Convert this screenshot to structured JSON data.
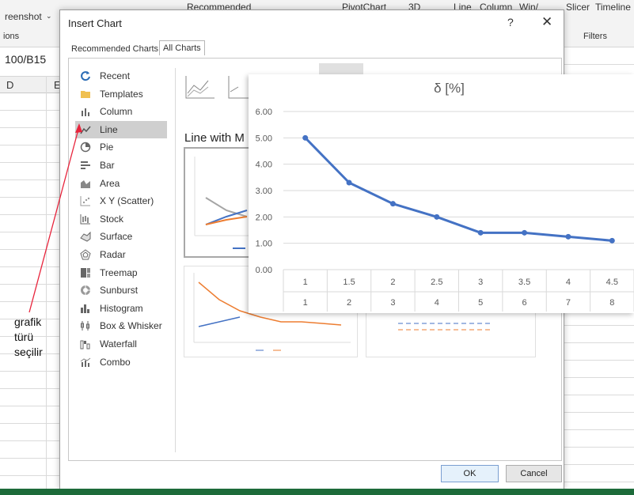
{
  "excel": {
    "ribbon": {
      "screenshot_label": "reenshot",
      "options_label": "ions",
      "recommended_label": "Recommended",
      "pivotchart_label": "PivotChart",
      "map3d_label": "3D",
      "line_label": "Line",
      "column_label": "Column",
      "winloss_label": "Win/",
      "slicer_label": "Slicer",
      "timeline_label": "Timeline",
      "filters_label": "Filters"
    },
    "name_box": "100/B15",
    "col_headers": [
      "D",
      "E"
    ]
  },
  "annotation": {
    "lines": [
      "grafik",
      "türü",
      "seçilir"
    ],
    "color": "#e8243c"
  },
  "dialog": {
    "title": "Insert Chart",
    "help_icon": "?",
    "close_icon": "✕",
    "tabs": [
      "Recommended Charts",
      "All Charts"
    ],
    "active_tab": "All Charts",
    "chart_types": [
      {
        "label": "Recent",
        "icon": "recent-icon"
      },
      {
        "label": "Templates",
        "icon": "templates-icon"
      },
      {
        "label": "Column",
        "icon": "column-chart-icon"
      },
      {
        "label": "Line",
        "icon": "line-chart-icon"
      },
      {
        "label": "Pie",
        "icon": "pie-chart-icon"
      },
      {
        "label": "Bar",
        "icon": "bar-chart-icon"
      },
      {
        "label": "Area",
        "icon": "area-chart-icon"
      },
      {
        "label": "X Y (Scatter)",
        "icon": "scatter-chart-icon"
      },
      {
        "label": "Stock",
        "icon": "stock-chart-icon"
      },
      {
        "label": "Surface",
        "icon": "surface-chart-icon"
      },
      {
        "label": "Radar",
        "icon": "radar-chart-icon"
      },
      {
        "label": "Treemap",
        "icon": "treemap-icon"
      },
      {
        "label": "Sunburst",
        "icon": "sunburst-icon"
      },
      {
        "label": "Histogram",
        "icon": "histogram-icon"
      },
      {
        "label": "Box & Whisker",
        "icon": "box-whisker-icon"
      },
      {
        "label": "Waterfall",
        "icon": "waterfall-icon"
      },
      {
        "label": "Combo",
        "icon": "combo-chart-icon"
      }
    ],
    "selected_type": "Line",
    "subtype_name": "Line with M",
    "ok_label": "OK",
    "cancel_label": "Cancel",
    "accent_color": "#4472c4",
    "orange_color": "#ed7d31"
  },
  "chart_data": {
    "type": "line",
    "title": "δ [%]",
    "categories": [
      "1",
      "1.5",
      "2",
      "2.5",
      "3",
      "3.5",
      "4",
      "4.5"
    ],
    "categories_level2": [
      "1",
      "2",
      "3",
      "4",
      "5",
      "6",
      "7",
      "8"
    ],
    "series": [
      {
        "values": [
          5.0,
          3.3,
          2.5,
          2.0,
          1.4,
          1.4,
          1.25,
          1.1
        ],
        "color": "#4472c4"
      }
    ],
    "ylim": [
      0,
      6
    ],
    "yticks": [
      "0.00",
      "1.00",
      "2.00",
      "3.00",
      "4.00",
      "5.00",
      "6.00"
    ],
    "grid": true
  }
}
